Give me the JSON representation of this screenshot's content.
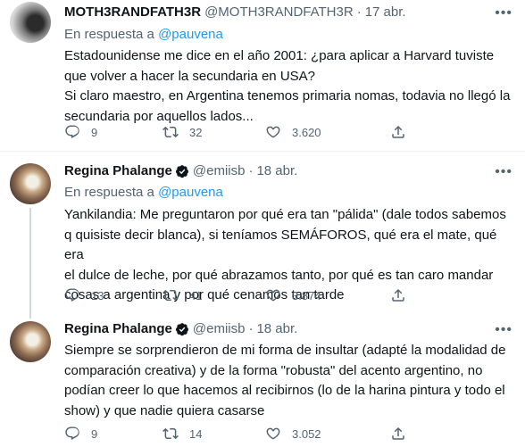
{
  "tweets": [
    {
      "name": "MOTH3RANDFATH3R",
      "handle": "@MOTH3RANDFATH3R",
      "sep": "·",
      "date": "17 abr.",
      "reply_prefix": "En respuesta a ",
      "reply_to": "@pauvena",
      "text": "Estadounidense me dice en el año 2001: ¿para aplicar a Harvard tuviste\nque volver a hacer la secundaria en USA?\nSi claro maestro, en Argentina tenemos primaria nomas, todavia no llegó la\nsecundaria por aquellos lados...",
      "replies": "9",
      "retweets": "32",
      "likes": "3.620"
    },
    {
      "name": "Regina Phalange",
      "handle": "@emiisb",
      "sep": "·",
      "date": "18 abr.",
      "reply_prefix": "En respuesta a ",
      "reply_to": "@pauvena",
      "text": "Yankilandia: Me preguntaron por qué era tan \"pálida\" (dale todos sabemos\nq quisiste decir blanca), si teníamos SEMÁFOROS, qué era el mate, qué era\nel dulce de leche, por qué abrazamos tanto, por qué es tan caro mandar\ncosas a argentina y por qué cenamos tan tarde",
      "replies": "13",
      "retweets": "41",
      "likes": "3.874"
    },
    {
      "name": "Regina Phalange",
      "handle": "@emiisb",
      "sep": "·",
      "date": "18 abr.",
      "text": "Siempre se sorprendieron de mi forma de insultar (adapté la modalidad de\ncomparación creativa) y de la forma \"robusta\" del acento argentino, no\npodían creer lo que hacemos al recibirnos (lo de la harina pintura y todo el\nshow) y que nadie quiera casarse",
      "replies": "9",
      "retweets": "14",
      "likes": "3.052"
    }
  ],
  "colors": {
    "link": "#1d9bf0",
    "muted": "#536471",
    "text": "#0f1419",
    "verified": "#1d9bf0"
  },
  "icons": [
    "more-icon",
    "verified-badge-icon",
    "reply-icon",
    "retweet-icon",
    "like-icon",
    "share-icon"
  ]
}
